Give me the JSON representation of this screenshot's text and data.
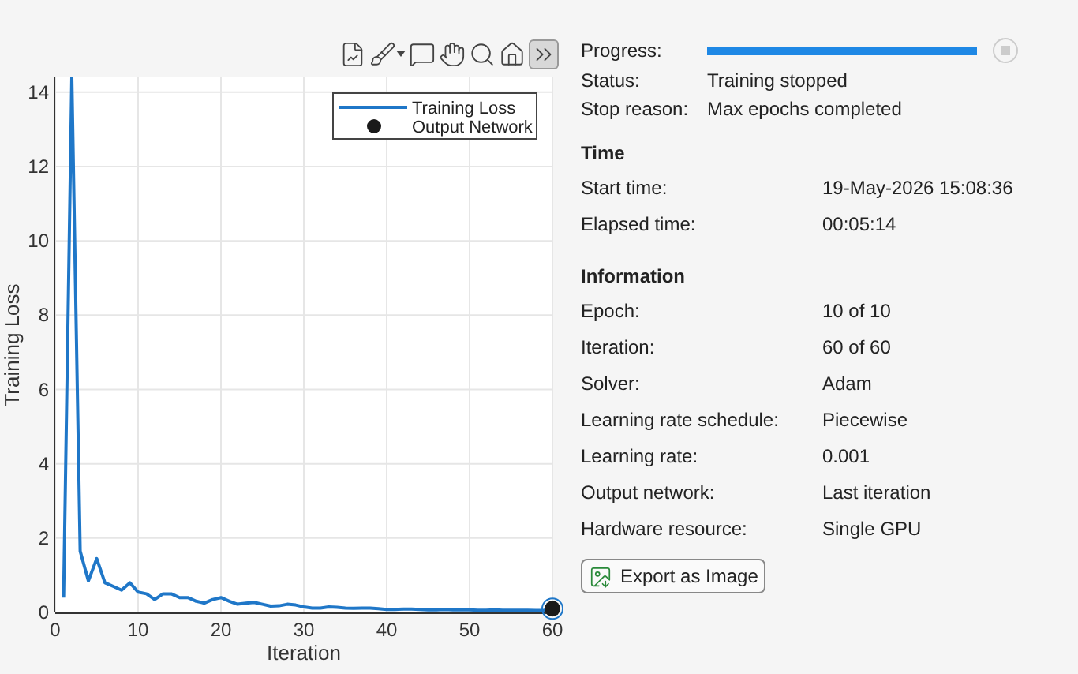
{
  "toolbar": [
    {
      "kind": "export"
    },
    {
      "kind": "brush"
    },
    {
      "kind": "datatip"
    },
    {
      "kind": "pan"
    },
    {
      "kind": "zoom"
    },
    {
      "kind": "home"
    },
    {
      "kind": "collapse"
    }
  ],
  "plot": {
    "chart_data": {
      "type": "line",
      "grid": true,
      "legend": true,
      "xlabel": "Iteration",
      "ylabel": "Training Loss",
      "xlim": [
        0,
        60
      ],
      "ylim": [
        0,
        14.4
      ],
      "xticks": [
        0,
        10,
        20,
        30,
        40,
        50,
        60
      ],
      "yticks": [
        0,
        2,
        4,
        6,
        8,
        10,
        12,
        14
      ],
      "x": [
        1,
        2,
        3,
        4,
        5,
        6,
        7,
        8,
        9,
        10,
        11,
        12,
        13,
        14,
        15,
        16,
        17,
        18,
        19,
        20,
        21,
        22,
        23,
        24,
        25,
        26,
        27,
        28,
        29,
        30,
        31,
        32,
        33,
        34,
        35,
        36,
        37,
        38,
        39,
        40,
        41,
        42,
        43,
        44,
        45,
        46,
        47,
        48,
        49,
        50,
        51,
        52,
        53,
        54,
        55,
        56,
        57,
        58,
        59,
        60
      ],
      "series": [
        {
          "name": "Training Loss",
          "color": "#1f77c8",
          "values": [
            0.4,
            14.4,
            1.65,
            0.85,
            1.45,
            0.8,
            0.7,
            0.6,
            0.8,
            0.55,
            0.5,
            0.35,
            0.5,
            0.5,
            0.4,
            0.4,
            0.3,
            0.25,
            0.35,
            0.4,
            0.3,
            0.22,
            0.25,
            0.27,
            0.22,
            0.17,
            0.18,
            0.22,
            0.2,
            0.15,
            0.12,
            0.12,
            0.15,
            0.14,
            0.12,
            0.11,
            0.12,
            0.12,
            0.1,
            0.08,
            0.08,
            0.09,
            0.09,
            0.08,
            0.07,
            0.07,
            0.08,
            0.07,
            0.07,
            0.07,
            0.06,
            0.06,
            0.07,
            0.06,
            0.06,
            0.06,
            0.06,
            0.05,
            0.06,
            0.1
          ]
        },
        {
          "name": "Output Network",
          "color": "#1a1a1a",
          "marker": "o",
          "values": [
            null,
            null,
            null,
            null,
            null,
            null,
            null,
            null,
            null,
            null,
            null,
            null,
            null,
            null,
            null,
            null,
            null,
            null,
            null,
            null,
            null,
            null,
            null,
            null,
            null,
            null,
            null,
            null,
            null,
            null,
            null,
            null,
            null,
            null,
            null,
            null,
            null,
            null,
            null,
            null,
            null,
            null,
            null,
            null,
            null,
            null,
            null,
            null,
            null,
            null,
            null,
            null,
            null,
            null,
            null,
            null,
            null,
            null,
            null,
            0.1
          ]
        }
      ]
    }
  },
  "progress": {
    "label": "Progress:",
    "level": 1
  },
  "stop_button": {
    "disabled": true
  },
  "status_rows": [
    {
      "label": "Status:",
      "value": "Training stopped"
    },
    {
      "label": "Stop reason:",
      "value": "Max epochs completed"
    }
  ],
  "sections": [
    {
      "title": "Time",
      "rows": [
        {
          "label": "Start time:",
          "value": "19-May-2026 15:08:36"
        },
        {
          "label": "Elapsed time:",
          "value": "00:05:14"
        }
      ]
    },
    {
      "title": "Information",
      "rows": [
        {
          "label": "Epoch:",
          "value": "10 of 10"
        },
        {
          "label": "Iteration:",
          "value": "60 of 60"
        },
        {
          "label": "Solver:",
          "value": "Adam"
        },
        {
          "label": "Learning rate schedule:",
          "value": "Piecewise"
        },
        {
          "label": "Learning rate:",
          "value": "0.001"
        },
        {
          "label": "Output network:",
          "value": "Last iteration"
        },
        {
          "label": "Hardware resource:",
          "value": "Single GPU"
        }
      ]
    }
  ],
  "export_button": {
    "label": "Export as Image"
  }
}
